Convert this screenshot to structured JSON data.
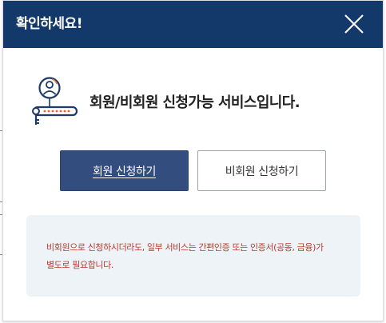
{
  "dialog": {
    "title": "확인하세요!",
    "close_icon": "close-icon",
    "notice_icon": "user-key-icon",
    "notice": "회원/비회원 신청가능 서비스입니다.",
    "buttons": {
      "member": "회원 신청하기",
      "nonmember": "비회원 신청하기"
    },
    "info_lines": [
      "비회원으로 신청하시더라도, 일부 서비스는 간편인증 또는 인증서(공동, 금융)가",
      "별도로 필요합니다."
    ]
  },
  "colors": {
    "header_bg": "#13386a",
    "primary_button": "#334e7e",
    "info_bg": "#eef3f8",
    "info_text": "#c0392b"
  }
}
